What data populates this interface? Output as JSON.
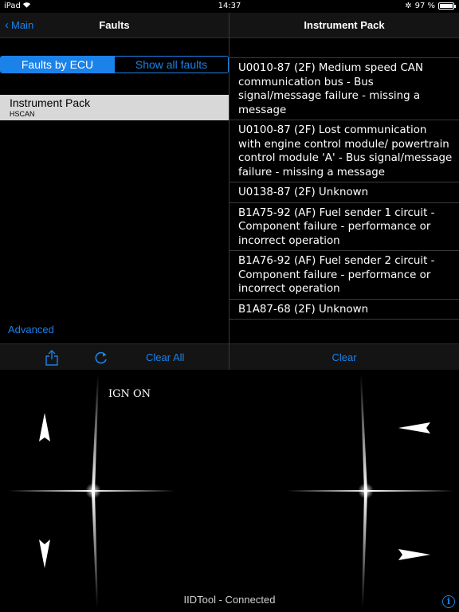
{
  "status_bar": {
    "carrier": "iPad",
    "time": "14:37",
    "battery_text": "97 %",
    "battery_level": 0.97
  },
  "left_pane": {
    "back_label": "Main",
    "title": "Faults",
    "segments": [
      "Faults by ECU",
      "Show all faults"
    ],
    "selected_segment": "Faults by ECU",
    "ecu_items": [
      {
        "name": "Instrument Pack",
        "bus": "HSCAN"
      }
    ],
    "advanced_label": "Advanced",
    "toolbar": {
      "clear_all_label": "Clear All"
    }
  },
  "right_pane": {
    "title": "Instrument Pack",
    "faults": [
      "U0010-87 (2F) Medium speed CAN communication bus - Bus signal/message failure - missing a message",
      "U0100-87 (2F) Lost communication with engine control module/ powertrain control module 'A' - Bus signal/message failure - missing a message",
      "U0138-87 (2F) Unknown",
      "B1A75-92 (AF) Fuel sender 1 circuit - Component failure - performance or incorrect operation",
      "B1A76-92 (AF) Fuel sender 2 circuit - Component failure - performance or incorrect operation",
      "B1A87-68 (2F) Unknown"
    ],
    "clear_label": "Clear"
  },
  "bottom_panel": {
    "ign_label": "IGN ON",
    "connection_status": "IIDTool - Connected",
    "info_glyph": "i"
  },
  "colors": {
    "accent": "#1a82e8",
    "background": "#000000",
    "bar": "#141414",
    "selected_row": "#d8d8d8"
  }
}
